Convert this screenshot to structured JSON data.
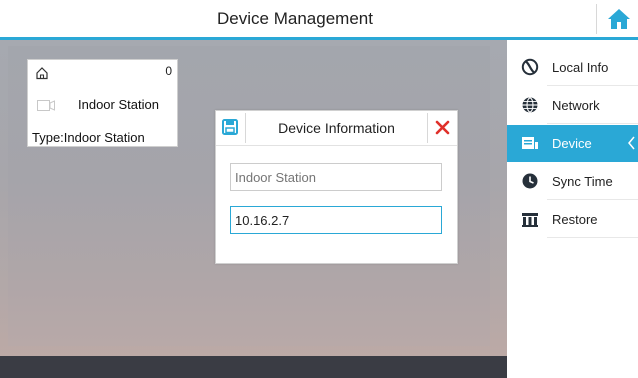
{
  "header": {
    "title": "Device Management"
  },
  "colors": {
    "accent": "#2aa8d6",
    "close": "#e0302a",
    "icon_dark": "#26303a"
  },
  "device_card": {
    "count": "0",
    "name": "Indoor Station",
    "type_text": "Type:Indoor Station",
    "icons": [
      "home-outline-icon",
      "camera-icon"
    ]
  },
  "dialog": {
    "title": "Device Information",
    "name_field": {
      "value": "",
      "placeholder": "Indoor Station"
    },
    "ip_field": {
      "value": "10.16.2.7"
    },
    "icons": [
      "save-icon",
      "close-icon"
    ]
  },
  "sidebar": {
    "items": [
      {
        "label": "Local Info",
        "icon": "local-info-icon",
        "active": false
      },
      {
        "label": "Network",
        "icon": "network-icon",
        "active": false
      },
      {
        "label": "Device",
        "icon": "device-icon",
        "active": true
      },
      {
        "label": "Sync Time",
        "icon": "clock-icon",
        "active": false
      },
      {
        "label": "Restore",
        "icon": "restore-icon",
        "active": false
      }
    ]
  }
}
